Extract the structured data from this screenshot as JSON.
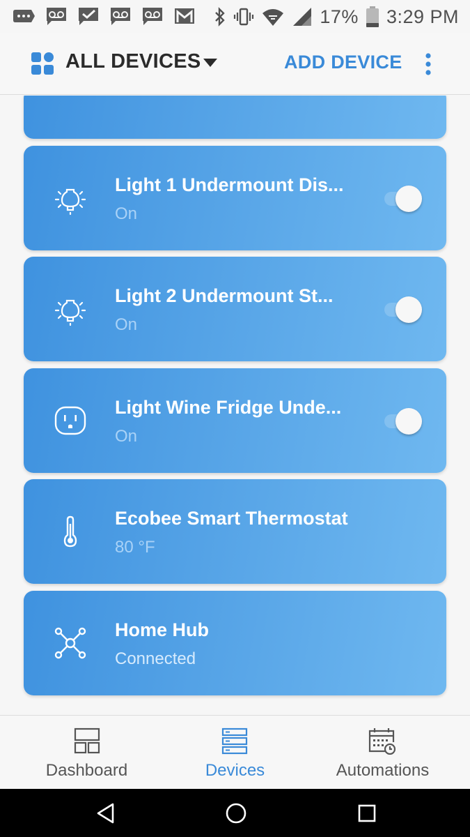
{
  "status_bar": {
    "battery": "17%",
    "time": "3:29 PM",
    "left_icons": [
      "message-icon",
      "voicemail-icon",
      "checkmark-inbox-icon",
      "voicemail-icon",
      "voicemail-icon",
      "gmail-icon"
    ],
    "right_icons": [
      "bluetooth-icon",
      "vibrate-icon",
      "wifi-icon",
      "cellular-signal-icon",
      "battery-icon"
    ]
  },
  "app_bar": {
    "title": "ALL DEVICES",
    "add_device_label": "ADD DEVICE",
    "accent_color": "#3a8ad8"
  },
  "devices": [
    {
      "name": "Light 1 Undermount Dis...",
      "status": "On",
      "icon": "bulb-icon",
      "has_toggle": true,
      "toggle_on": true
    },
    {
      "name": "Light 2 Undermount St...",
      "status": "On",
      "icon": "bulb-icon",
      "has_toggle": true,
      "toggle_on": true
    },
    {
      "name": "Light Wine Fridge Unde...",
      "status": "On",
      "icon": "outlet-icon",
      "has_toggle": true,
      "toggle_on": true
    },
    {
      "name": "Ecobee Smart Thermostat",
      "status": "80 °F",
      "icon": "thermometer-icon",
      "has_toggle": false
    },
    {
      "name": "Home Hub",
      "status": "Connected",
      "icon": "hub-icon",
      "has_toggle": false
    }
  ],
  "bottom_nav": {
    "items": [
      {
        "label": "Dashboard",
        "icon": "dashboard-icon",
        "active": false
      },
      {
        "label": "Devices",
        "icon": "devices-icon",
        "active": true
      },
      {
        "label": "Automations",
        "icon": "automations-icon",
        "active": false
      }
    ]
  },
  "system_nav": [
    "back-icon",
    "home-icon",
    "recents-icon"
  ]
}
